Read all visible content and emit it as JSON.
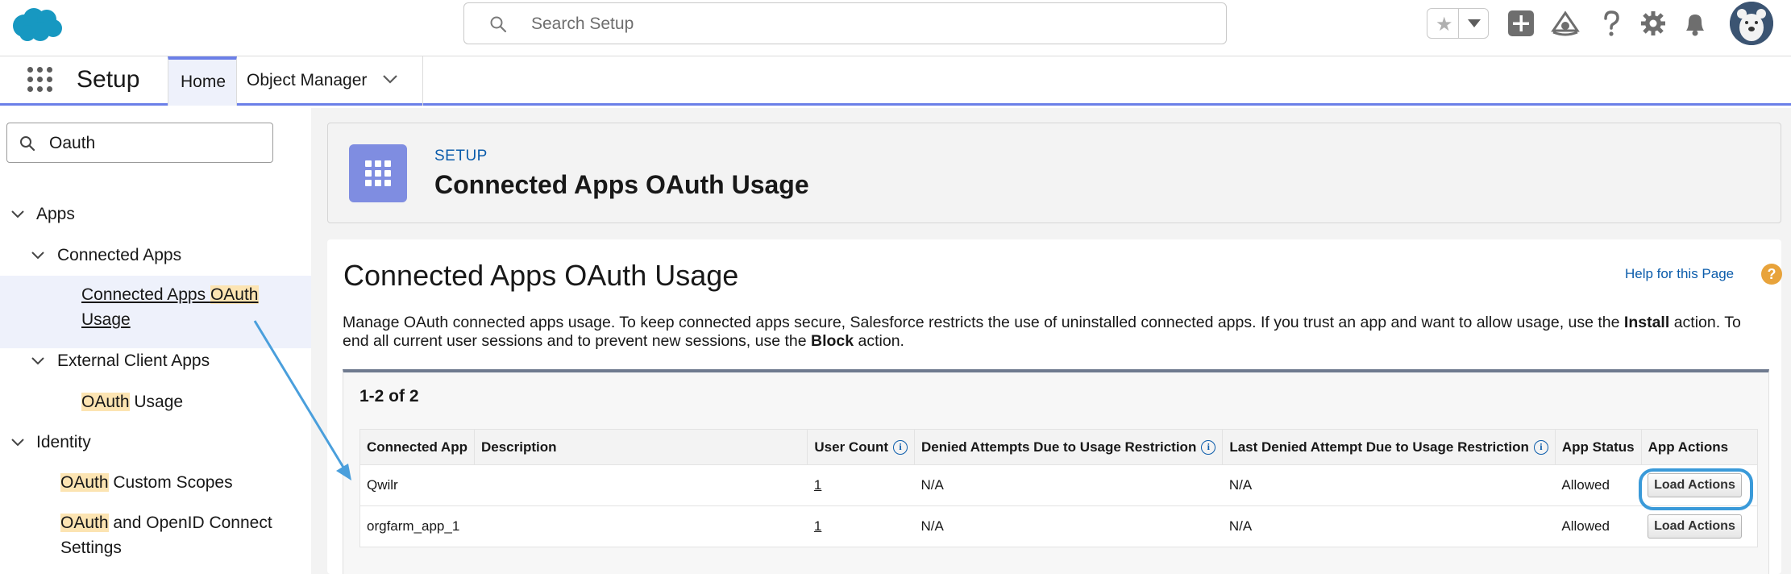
{
  "header": {
    "search_placeholder": "Search Setup",
    "icons": [
      "salesforce-cloud-logo",
      "favorites-star-icon",
      "add-icon",
      "trailhead-icon",
      "help-icon",
      "setup-gear-icon",
      "notifications-bell-icon",
      "user-avatar"
    ]
  },
  "nav": {
    "app_name": "Setup",
    "tabs": [
      {
        "label": "Home",
        "active": true
      },
      {
        "label": "Object Manager",
        "has_dropdown": true
      }
    ]
  },
  "sidebar": {
    "quick_find_value": "Oauth",
    "tree": {
      "apps": "Apps",
      "connected_apps": "Connected Apps",
      "cao_prefix": "Connected Apps ",
      "cao_highlight": "OAuth",
      "cao_line2": "Usage",
      "external_client_apps": "External Client Apps",
      "eca_highlight": "OAuth",
      "eca_suffix": " Usage",
      "identity": "Identity",
      "ocs_highlight": "OAuth",
      "ocs_suffix": " Custom Scopes",
      "oidc_highlight": "OAuth",
      "oidc_suffix": " and OpenID Connect",
      "oidc_line2": "Settings"
    }
  },
  "page_header": {
    "eyebrow": "SETUP",
    "title": "Connected Apps OAuth Usage"
  },
  "content": {
    "title": "Connected Apps OAuth Usage",
    "help_link": "Help for this Page",
    "description_part1": "Manage OAuth connected apps usage. To keep connected apps secure, Salesforce restricts the use of uninstalled connected apps. If you trust an app and want to allow usage, use the ",
    "description_bold1": "Install",
    "description_part2": " action. To end all current user sessions and to prevent new sessions, use the ",
    "description_bold2": "Block",
    "description_part3": " action.",
    "count_label": "1-2 of 2"
  },
  "table": {
    "columns": [
      "Connected App",
      "Description",
      "User Count",
      "Denied Attempts Due to Usage Restriction",
      "Last Denied Attempt Due to Usage Restriction",
      "App Status",
      "App Actions"
    ],
    "rows": [
      {
        "app": "Qwilr",
        "description": "",
        "user_count": "1",
        "denied": "N/A",
        "last_denied": "N/A",
        "status": "Allowed",
        "action": "Load Actions"
      },
      {
        "app": "orgfarm_app_1",
        "description": "",
        "user_count": "1",
        "denied": "N/A",
        "last_denied": "N/A",
        "status": "Allowed",
        "action": "Load Actions"
      }
    ]
  },
  "colors": {
    "brand_blue": "#0b5cab",
    "nav_accent": "#6b7fe8",
    "highlight": "#fce4b2",
    "annotation": "#3a9ad9"
  }
}
